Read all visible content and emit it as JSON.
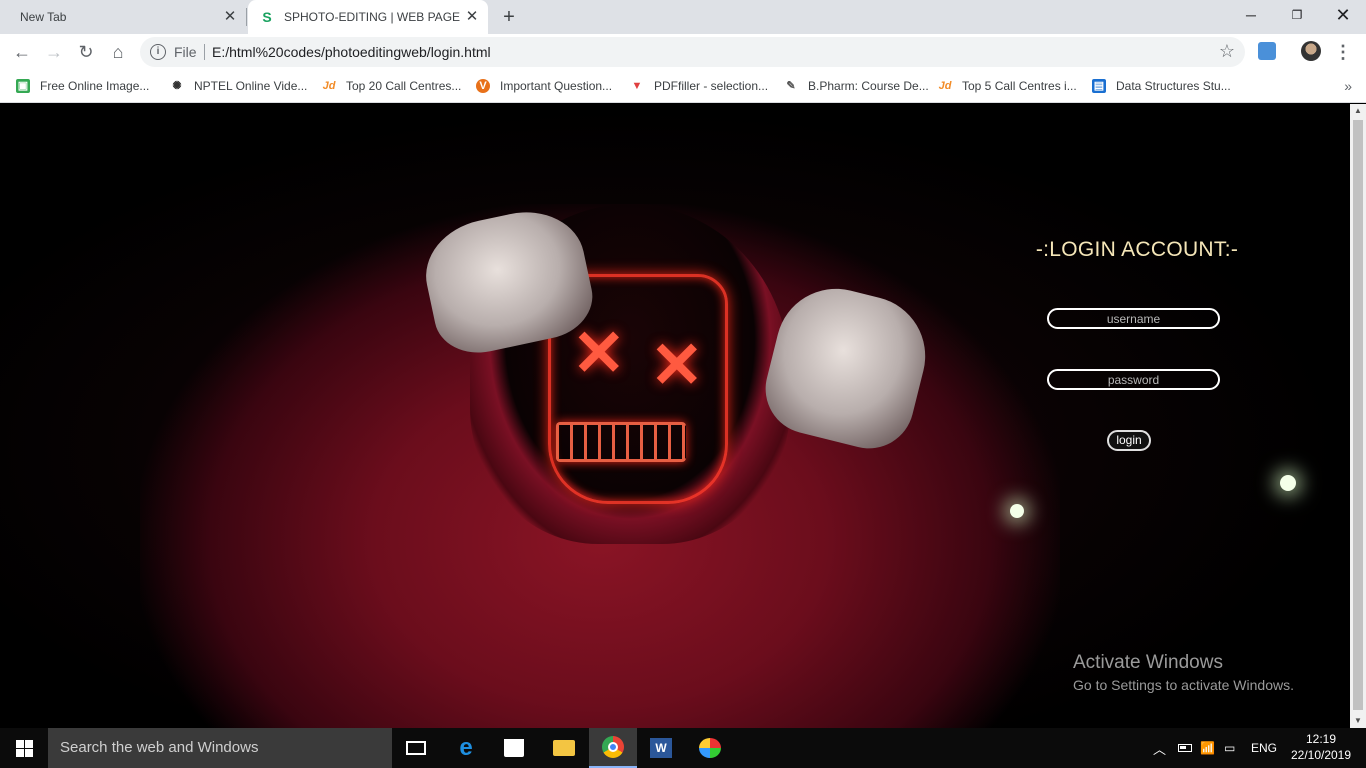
{
  "browser": {
    "tabs": [
      {
        "title": "New Tab",
        "active": false
      },
      {
        "title": "SPHOTO-EDITING | WEB PAGE",
        "active": true
      }
    ],
    "omnibox": {
      "scheme_label": "File",
      "url": "E:/html%20codes/photoeditingweb/login.html"
    },
    "bookmarks": [
      {
        "label": "Free Online Image...",
        "icon": "image-icon",
        "color": "#34a853"
      },
      {
        "label": "NPTEL Online Vide...",
        "icon": "nptel-icon",
        "color": "#333333"
      },
      {
        "label": "Top 20 Call Centres...",
        "icon": "jd-icon",
        "color": "#f28c28"
      },
      {
        "label": "Important Question...",
        "icon": "v-icon",
        "color": "#e8711a"
      },
      {
        "label": "PDFfiller - selection...",
        "icon": "pdffiller-icon",
        "color": "#e04040"
      },
      {
        "label": "B.Pharm: Course De...",
        "icon": "pharm-icon",
        "color": "#555555"
      },
      {
        "label": "Top 5 Call Centres i...",
        "icon": "jd-icon",
        "color": "#f28c28"
      },
      {
        "label": "Data Structures Stu...",
        "icon": "ds-icon",
        "color": "#1a6fd1"
      }
    ]
  },
  "login": {
    "title": "-:LOGIN ACCOUNT:-",
    "username_placeholder": "username",
    "password_placeholder": "password",
    "button_label": "login"
  },
  "watermark": {
    "title": "Activate Windows",
    "subtitle": "Go to Settings to activate Windows."
  },
  "taskbar": {
    "search_placeholder": "Search the web and Windows",
    "language": "ENG",
    "time": "12:19",
    "date": "22/10/2019",
    "pinned": [
      "task-view-icon",
      "edge-icon",
      "store-icon",
      "file-explorer-icon",
      "chrome-icon",
      "word-icon",
      "paint-icon"
    ]
  },
  "colors": {
    "login_title": "#f5e6b8",
    "mask_glow": "#ff3a2a",
    "hoodie": "#8a1425"
  }
}
